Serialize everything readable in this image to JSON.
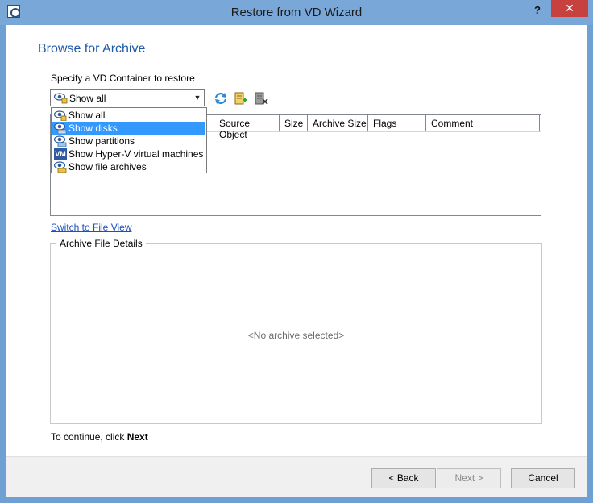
{
  "window": {
    "title": "Restore from VD Wizard",
    "help_label": "?",
    "close_label": "✕"
  },
  "page": {
    "heading": "Browse for Archive",
    "specify_label": "Specify a VD Container to restore",
    "combo_value": "Show all",
    "switch_link": "Switch to File View",
    "group_label": "Archive File Details",
    "no_archive": "<No archive selected>",
    "continue_prefix": "To continue, click ",
    "continue_bold": "Next"
  },
  "dropdown": {
    "options": [
      {
        "label": "Show all",
        "icon": "eye-icon"
      },
      {
        "label": "Show disks",
        "icon": "disk-icon"
      },
      {
        "label": "Show partitions",
        "icon": "partition-icon"
      },
      {
        "label": "Show Hyper-V virtual machines",
        "icon": "vm-icon",
        "icon_text": "VM"
      },
      {
        "label": "Show file archives",
        "icon": "archive-icon"
      }
    ],
    "selected_index": 1
  },
  "columns": [
    "Source Object",
    "Size",
    "Archive Size",
    "Flags",
    "Comment"
  ],
  "buttons": {
    "back": "< Back",
    "next": "Next >",
    "cancel": "Cancel"
  },
  "colors": {
    "accent": "#1e5aa8",
    "selection": "#3399ff",
    "close": "#c7413f"
  }
}
